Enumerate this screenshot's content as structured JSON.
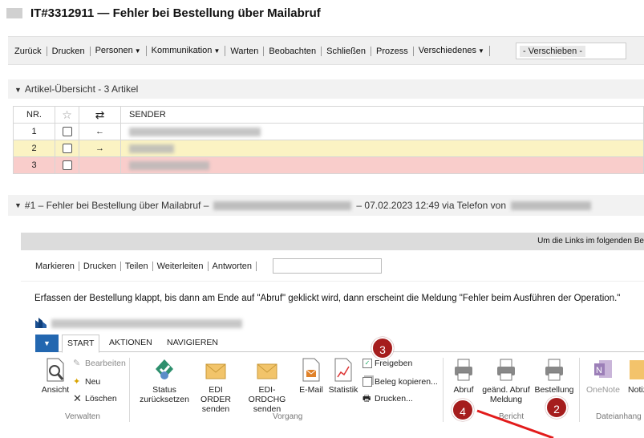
{
  "header": {
    "title": "IT#3312911 — Fehler bei Bestellung über Mailabruf"
  },
  "toolbar": {
    "items": [
      "Zurück",
      "Drucken",
      "Personen",
      "Kommunikation",
      "Warten",
      "Beobachten",
      "Schließen",
      "Prozess",
      "Verschiedenes"
    ],
    "move_value": "- Verschieben -"
  },
  "articles": {
    "heading": "Artikel-Übersicht - 3 Artikel",
    "columns": {
      "nr": "NR.",
      "star": "☆",
      "dir": "⇄",
      "sender": "SENDER"
    },
    "rows": [
      {
        "nr": "1",
        "dir": "←"
      },
      {
        "nr": "2",
        "dir": "→"
      },
      {
        "nr": "3",
        "dir": ""
      }
    ]
  },
  "email": {
    "heading_prefix": "#1 – Fehler bei Bestellung über Mailabruf –",
    "heading_mid": "– 07.02.2023 12:49 via Telefon von",
    "notice": "Um die Links im folgenden Be",
    "actions": [
      "Markieren",
      "Drucken",
      "Teilen",
      "Weiterleiten",
      "Antworten"
    ],
    "message": "Erfassen der Bestellung klappt, bis dann am Ende auf \"Abruf\" geklickt wird, dann erscheint die Meldung \"Fehler beim Ausführen der Operation.\""
  },
  "ribbon": {
    "tabs": [
      "START",
      "AKTIONEN",
      "NAVIGIEREN"
    ],
    "groups": {
      "verwalten": {
        "label": "Verwalten",
        "ansicht": "Ansicht",
        "bearbeiten": "Bearbeiten",
        "neu": "Neu",
        "loeschen": "Löschen"
      },
      "vorgang": {
        "label": "Vorgang",
        "status_1": "Status",
        "status_2": "zurücksetzen",
        "edi_order_1": "EDI ORDER",
        "edi_order_2": "senden",
        "edi_ordchg_1": "EDI-ORDCHG",
        "edi_ordchg_2": "senden",
        "email": "E-Mail",
        "statistik": "Statistik",
        "freigeben": "Freigeben",
        "beleg_kopieren": "Beleg kopieren...",
        "drucken": "Drucken..."
      },
      "bericht": {
        "label": "Bericht",
        "abruf": "Abruf",
        "geaend_1": "geänd. Abruf",
        "geaend_2": "Meldung",
        "bestellung": "Bestellung"
      },
      "dateianhang": {
        "label": "Dateianhang",
        "onenote": "OneNote",
        "notiz": "Notiz"
      }
    }
  },
  "annotations": {
    "b1": "2",
    "b2": "3",
    "b3": "4"
  },
  "colors": {
    "row_yellow": "#fbf3c3",
    "row_red": "#f9cdcb",
    "file_tab": "#2367b0",
    "badge": "#a51d1d",
    "arrow": "#e21b1b"
  }
}
